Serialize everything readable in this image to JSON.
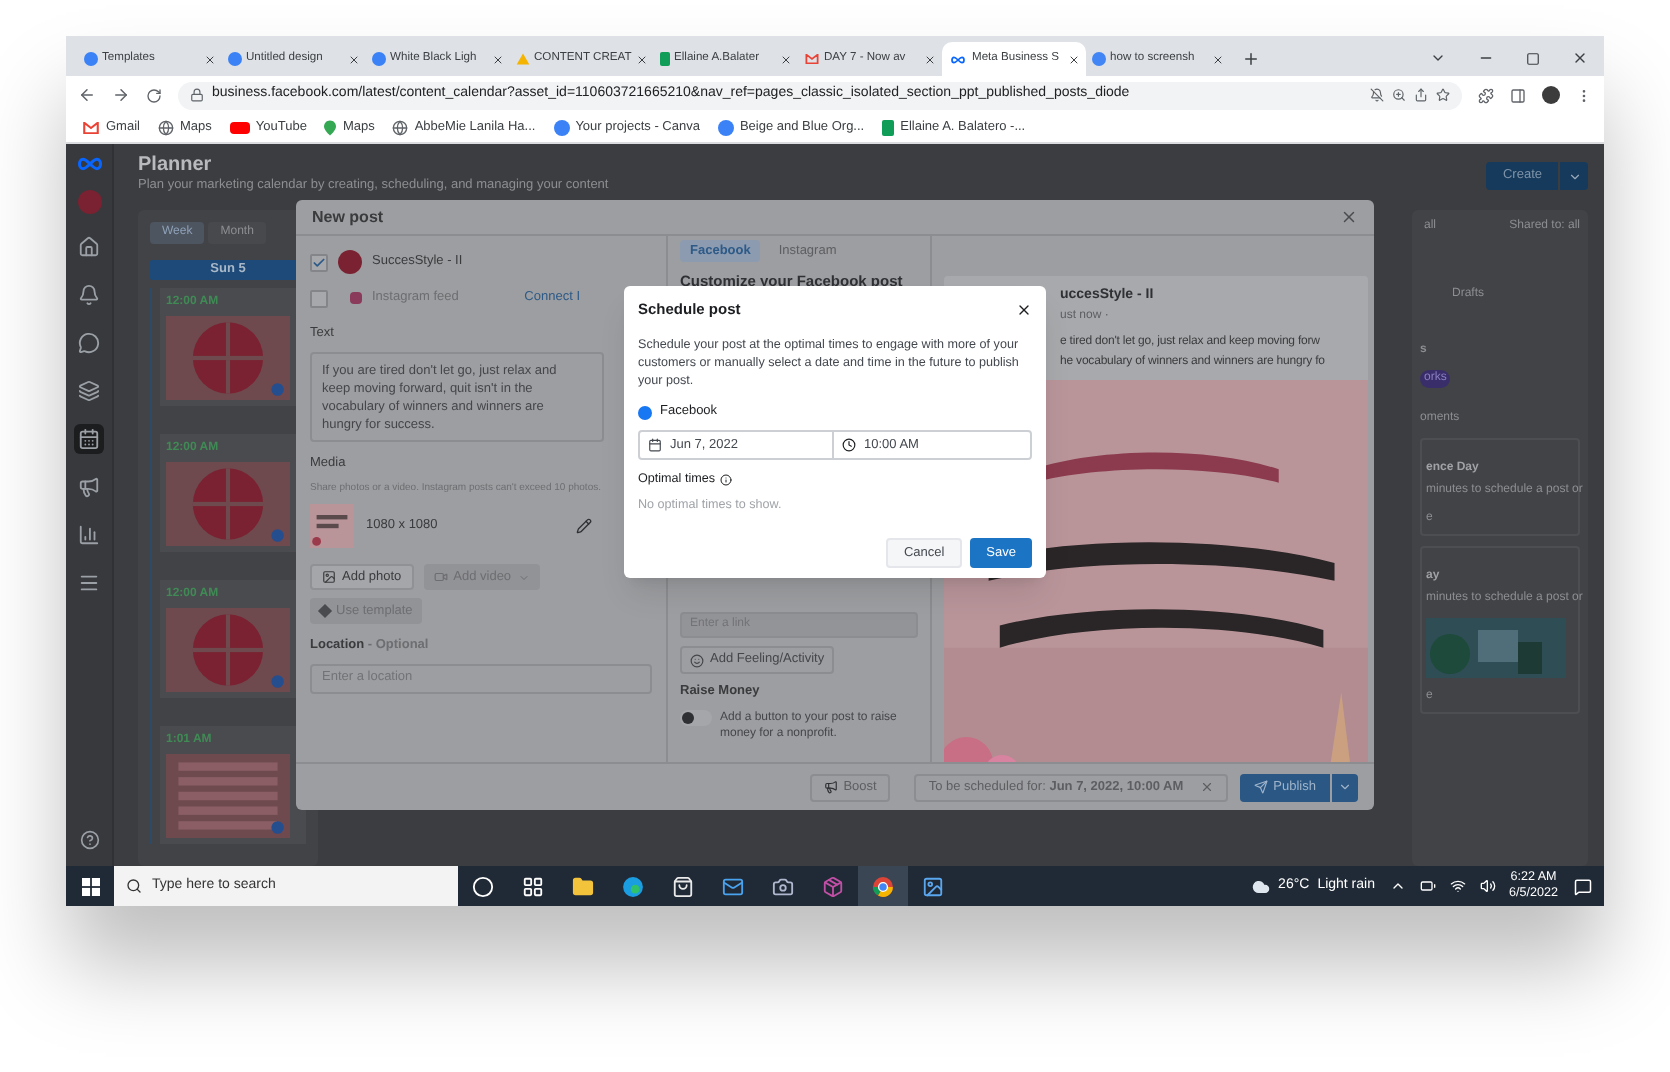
{
  "browser": {
    "tabs": [
      {
        "title": "Templates",
        "kind": "canva",
        "selected": false
      },
      {
        "title": "Untitled design",
        "kind": "canva",
        "selected": false
      },
      {
        "title": "White Black Ligh",
        "kind": "canva",
        "selected": false
      },
      {
        "title": "CONTENT CREAT",
        "kind": "drive",
        "selected": false
      },
      {
        "title": "Ellaine A.Balater",
        "kind": "sheets",
        "selected": false
      },
      {
        "title": "DAY 7 - Now av",
        "kind": "gmail",
        "selected": false
      },
      {
        "title": "Meta Business S",
        "kind": "meta",
        "selected": true
      },
      {
        "title": "how to screensh",
        "kind": "google",
        "selected": false
      }
    ],
    "url": "business.facebook.com/latest/content_calendar?asset_id=110603721665210&nav_ref=pages_classic_isolated_section_ppt_published_posts_diode",
    "bookmarks": [
      {
        "label": "Gmail",
        "kind": "gmail"
      },
      {
        "label": "Maps",
        "kind": "globe"
      },
      {
        "label": "YouTube",
        "kind": "youtube"
      },
      {
        "label": "Maps",
        "kind": "maps"
      },
      {
        "label": "AbbeMie Lanila Ha...",
        "kind": "globe"
      },
      {
        "label": "Your projects - Canva",
        "kind": "canva"
      },
      {
        "label": "Beige and Blue Org...",
        "kind": "canva"
      },
      {
        "label": "Ellaine A. Balatero -...",
        "kind": "sheets"
      }
    ]
  },
  "planner": {
    "title": "Planner",
    "subtitle": "Plan your marketing calendar by creating, scheduling, and managing your content",
    "create": "Create",
    "nav": [
      {
        "kind": "home",
        "selected": false
      },
      {
        "kind": "bell",
        "selected": false
      },
      {
        "kind": "chat",
        "selected": false
      },
      {
        "kind": "layers",
        "selected": false
      },
      {
        "kind": "calendar",
        "selected": true
      },
      {
        "kind": "megaphone",
        "selected": false
      },
      {
        "kind": "chart",
        "selected": false
      },
      {
        "kind": "menu",
        "selected": false
      }
    ],
    "view_tabs": [
      {
        "label": "Week",
        "selected": true
      },
      {
        "label": "Month",
        "selected": false
      }
    ],
    "day": "Sun 5",
    "posts": [
      {
        "time": "12:00 AM"
      },
      {
        "time": "12:00 AM"
      },
      {
        "time": "12:00 AM"
      },
      {
        "time": "1:01 AM"
      }
    ],
    "right": {
      "filter": "all",
      "shared": "Shared to: all",
      "tab": "Drafts",
      "heading": "s",
      "badge": "orks",
      "label": "oments",
      "cards": [
        {
          "title": "ence Day",
          "text": "minutes to schedule a post or",
          "select": "e"
        },
        {
          "title": "ay",
          "text": "minutes to schedule a post or",
          "select": "e"
        }
      ]
    }
  },
  "new_post": {
    "title": "New post",
    "accounts": [
      {
        "name": "SuccesStyle - II",
        "kind": "facebook",
        "checked": true
      },
      {
        "name": "Instagram feed",
        "kind": "instagram",
        "checked": false
      }
    ],
    "connect": "Connect I",
    "text_label": "Text",
    "text": "If you are tired don't let go, just relax and keep moving forward, quit isn't in the vocabulary of winners and winners are hungry for success.",
    "media_label": "Media",
    "media_hint": "Share photos or a video. Instagram posts can't exceed 10 photos.",
    "media_size": "1080 x 1080",
    "add_photo": "Add photo",
    "add_video": "Add video",
    "use_template": "Use template",
    "location_label": "Location",
    "location_optional": " - Optional",
    "location_placeholder": "Enter a location",
    "customize": {
      "tabs": [
        {
          "label": "Facebook",
          "selected": true
        },
        {
          "label": "Instagram",
          "selected": false
        }
      ],
      "title": "Customize your Facebook post",
      "link_placeholder": "Enter a link",
      "feeling": "Add Feeling/Activity",
      "raise_title": "Raise Money",
      "raise_text": "Add a button to your post to raise money for a nonprofit.",
      "raise_on": false
    },
    "preview": {
      "name": "uccesStyle - II",
      "meta": "ust now · ",
      "lines": [
        "e tired don't let go, just relax and keep moving forw",
        "he vocabulary of winners and winners are hungry fo"
      ]
    },
    "boost": "Boost",
    "scheduled": "To be scheduled for: **Jun 7, 2022, 10:00 AM**",
    "publish": "Publish"
  },
  "schedule": {
    "title": "Schedule post",
    "description": "Schedule your post at the optimal times to engage with more of your customers or manually select a date and time in the future to publish your post.",
    "platform": "Facebook",
    "date": "Jun 7, 2022",
    "time": "10:00 AM",
    "optimal_label": "Optimal times",
    "optimal_empty": "No optimal times to show.",
    "cancel": "Cancel",
    "save": "Save"
  },
  "taskbar": {
    "search_placeholder": "Type here to search",
    "apps": [
      {
        "kind": "cortana",
        "selected": false
      },
      {
        "kind": "taskview",
        "selected": false
      },
      {
        "kind": "folder",
        "selected": false
      },
      {
        "kind": "edge",
        "selected": false
      },
      {
        "kind": "store",
        "selected": false
      },
      {
        "kind": "mail",
        "selected": false
      },
      {
        "kind": "camera",
        "selected": false
      },
      {
        "kind": "archive",
        "selected": false
      },
      {
        "kind": "chrome",
        "selected": true
      },
      {
        "kind": "photos",
        "selected": false
      }
    ],
    "temperature": "26°C",
    "weather": "Light rain",
    "time": "6:22 AM",
    "date": "6/5/2022"
  }
}
